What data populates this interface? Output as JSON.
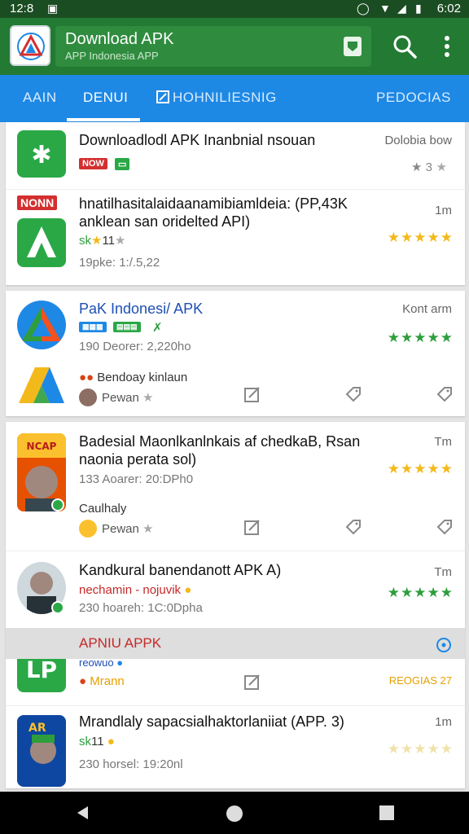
{
  "status": {
    "time": "12:8",
    "clock": "6:02"
  },
  "appbar": {
    "title": "Download APK",
    "subtitle": "APP Indonesia APP",
    "logo_icon": "apk-logo-icon",
    "search_icon": "search-icon",
    "menu_icon": "more-vert-icon"
  },
  "tabs": [
    {
      "label": "AAIN"
    },
    {
      "label": "DENUI"
    },
    {
      "label": "HOHNILIESNIG"
    },
    {
      "label": "PEDOCIAS"
    }
  ],
  "list": {
    "item1": {
      "title": "Downloadlodl APK Inanbnial nsouan",
      "right": "Dolobia bow",
      "badge": "NOW",
      "rating": "3"
    },
    "item2": {
      "badge": "NONN",
      "line1": "hnatilhasitalaidaanamibiamldeia: (PP,43K",
      "line2": "anklean san oridelted API)",
      "meta1": "11",
      "meta2": "19pke: 1:/.5,22",
      "right": "1m"
    },
    "item3": {
      "title": "PaK Indonesi/ APK",
      "right": "Kont arm",
      "meta": "190 Deorer: 2,220ho",
      "dev": "Bendoay kinlaun",
      "user": "Pewan"
    },
    "item4": {
      "line1": "Badesial Maonlkanlnkais af chedkaB, Rsan",
      "line2": "naonia perata sol)",
      "meta": "133 Aoarer: 20:DPh0",
      "right": "Tm",
      "dev": "Caulhaly",
      "user": "Pewan"
    },
    "item5": {
      "title": "Kandkural banendanott APK A)",
      "dev": "nechamin - nojuvik",
      "meta": "230 hoareh: 1C:0Dpha",
      "right": "Tm"
    },
    "banner": {
      "label": "APNIU APPK"
    },
    "item6": {
      "tag": "reowuo",
      "dev": "Mrann",
      "right": "REOGIAS 27"
    },
    "item7": {
      "title": "Mrandlaly sapacsialhaktorlaniiat (APP. 3)",
      "meta1": "11",
      "meta2": "230 horsel: 19:20nl",
      "right": "1m"
    }
  },
  "colors": {
    "green": "#237a33",
    "blue": "#1e88e5",
    "star": "#f3b91b",
    "red": "#d32f2f"
  }
}
